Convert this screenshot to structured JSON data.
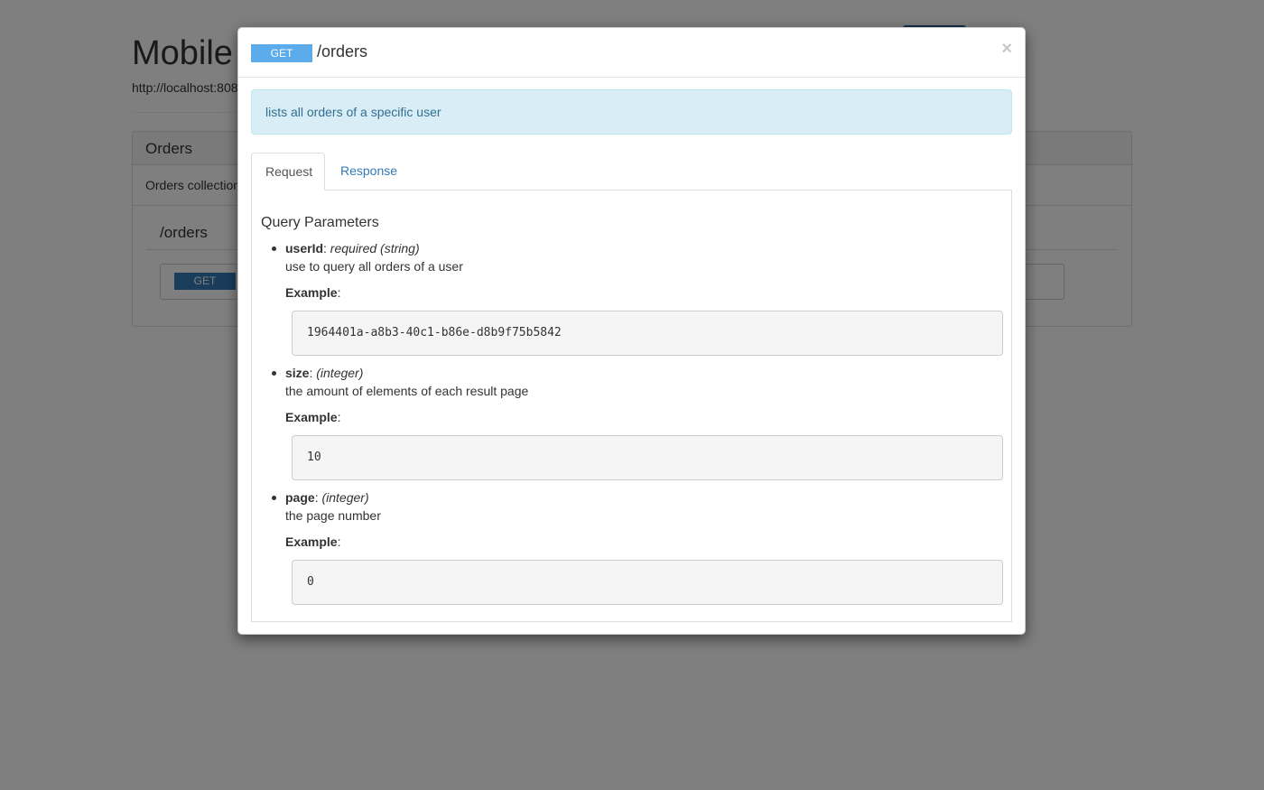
{
  "background": {
    "title": "Mobile",
    "base_url": "http://localhost:808",
    "panel": {
      "heading": "Orders",
      "description": "Orders collection",
      "resource": "/orders",
      "method": "GET"
    }
  },
  "modal": {
    "method": "GET",
    "path": "/orders",
    "close": "×",
    "description": "lists all orders of a specific user",
    "tabs": [
      {
        "label": "Request",
        "active": true
      },
      {
        "label": "Response",
        "active": false
      }
    ],
    "section_title": "Query Parameters",
    "example_label": "Example",
    "params": [
      {
        "name": "userId",
        "type": "required (string)",
        "description": "use to query all orders of a user",
        "example": "1964401a-a8b3-40c1-b86e-d8b9f75b5842"
      },
      {
        "name": "size",
        "type": "(integer)",
        "description": "the amount of elements of each result page",
        "example": "10"
      },
      {
        "name": "page",
        "type": "(integer)",
        "description": "the page number",
        "example": "0"
      }
    ]
  },
  "colors": {
    "get_badge": "#5cabea",
    "info_bg": "#d9edf7",
    "info_text": "#31708f",
    "link": "#337ab7"
  }
}
